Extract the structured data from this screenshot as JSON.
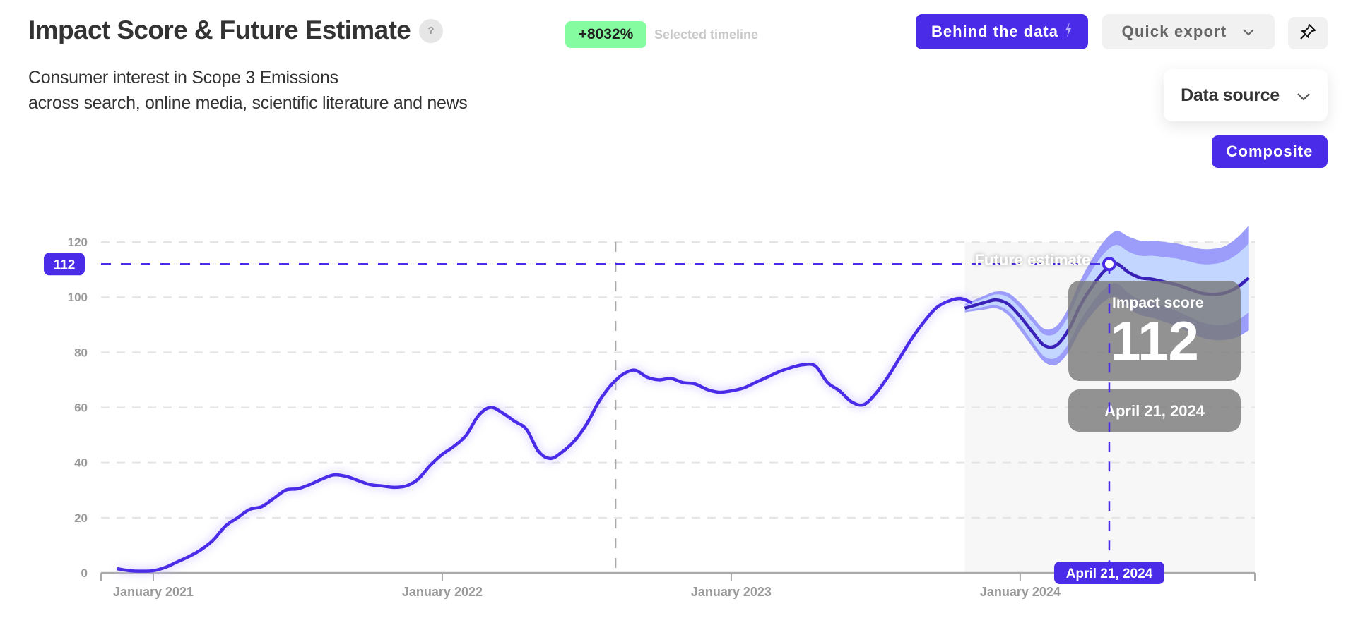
{
  "header": {
    "title": "Impact Score & Future Estimate",
    "help_label": "?",
    "subtitle_line1": "Consumer interest in Scope 3 Emissions",
    "subtitle_line2": "across search, online media, scientific literature and news",
    "change_badge": "+8032%",
    "change_note": "Selected timeline"
  },
  "toolbar": {
    "behind_the_data_label": "Behind the data",
    "quick_export_label": "Quick export",
    "data_source_label": "Data source",
    "composite_label": "Composite",
    "icons": {
      "behind": "lightning-icon",
      "export": "chevron-down-icon",
      "pin": "pin-icon",
      "data_source": "chevron-down-icon"
    }
  },
  "colors": {
    "accent": "#4a2ce8",
    "forecast_band_outer": "#9c9cfa",
    "forecast_band_inner": "#c3d6ff",
    "forecast_line": "#3a22b8",
    "forecast_bg": "#f7f7f7",
    "badge_green": "#86fca0"
  },
  "chart_data": {
    "type": "line",
    "title": "Impact Score & Future Estimate",
    "xlabel": "",
    "ylabel": "Impact score",
    "ylim": [
      0,
      120
    ],
    "yticks": [
      0,
      20,
      40,
      60,
      80,
      100,
      120
    ],
    "x_unit": "months since January 2021",
    "xlim": [
      -2.2,
      45.7
    ],
    "xticks": [
      {
        "x": 0,
        "label": "January 2021"
      },
      {
        "x": 12,
        "label": "January 2022"
      },
      {
        "x": 24,
        "label": "January 2023"
      },
      {
        "x": 36,
        "label": "January 2024"
      }
    ],
    "grid": true,
    "series": [
      {
        "name": "Impact score",
        "x": [
          -1.5,
          -1.0,
          -0.5,
          0,
          0.5,
          1,
          1.5,
          2,
          2.5,
          3,
          3.5,
          4,
          4.5,
          5,
          5.5,
          6,
          6.5,
          7,
          7.5,
          8,
          8.5,
          9,
          9.5,
          10,
          10.5,
          11,
          11.5,
          12,
          12.5,
          13,
          13.5,
          14,
          14.5,
          15,
          15.5,
          16,
          16.5,
          17,
          17.5,
          18,
          18.5,
          19,
          19.5,
          20,
          20.5,
          21,
          21.5,
          22,
          22.5,
          23,
          23.5,
          24,
          24.5,
          25,
          25.5,
          26,
          26.5,
          27,
          27.5,
          28,
          28.5,
          29,
          29.5,
          30,
          30.5,
          31,
          31.5,
          32,
          32.5,
          33,
          33.5,
          34
        ],
        "values": [
          1.5,
          0.8,
          0.6,
          0.8,
          2,
          4,
          6,
          8.5,
          12,
          17,
          20,
          23,
          24,
          27,
          30,
          30.5,
          32,
          34,
          35.5,
          35,
          33.5,
          32,
          31.5,
          31,
          31.5,
          34,
          39,
          43,
          46,
          50,
          57,
          60,
          58,
          55,
          52,
          44,
          41.5,
          44,
          48,
          54,
          62,
          68,
          72,
          73.5,
          71,
          70,
          70.5,
          69,
          68.5,
          66.5,
          65.5,
          66,
          67,
          69,
          71,
          73,
          74.5,
          75.5,
          75,
          69,
          66,
          62,
          61,
          65,
          71,
          78,
          85,
          91,
          96,
          98.5,
          99.5,
          98,
          97,
          92,
          86,
          83,
          81,
          81,
          84,
          90,
          94,
          96
        ]
      },
      {
        "name": "Future estimate",
        "x": [
          33.7,
          34.5,
          35,
          35.5,
          36,
          36.5,
          37,
          37.5,
          38,
          38.5,
          39,
          39.5,
          40,
          40.5,
          41,
          41.5,
          42,
          42.5,
          43,
          43.5,
          44,
          44.5,
          45,
          45.5
        ],
        "values": [
          96,
          98,
          99,
          97.5,
          93,
          87.5,
          82.5,
          82.5,
          88,
          97,
          104,
          109.5,
          112,
          109,
          107,
          106.5,
          105.5,
          104.5,
          103,
          101.5,
          101,
          101.5,
          103.5,
          107
        ],
        "band_inner_halfwidth": [
          1,
          1.5,
          2,
          2.5,
          3,
          3.5,
          4,
          4.5,
          5,
          5.5,
          6,
          6.5,
          7,
          7.5,
          8,
          8.5,
          9,
          9.5,
          10,
          10.5,
          11,
          11.5,
          12,
          12.5
        ],
        "band_outer_halfwidth": [
          1.5,
          2.5,
          3,
          4,
          5,
          5.5,
          6,
          7,
          8,
          9,
          10,
          11,
          12,
          13,
          13.5,
          14,
          14.5,
          15,
          15.5,
          16,
          16.5,
          17,
          18,
          19
        ]
      }
    ],
    "forecast_region_start": 33.7,
    "reference_line_x": 19.2,
    "annotations": {
      "forecast_label": "Future estimate",
      "selected_value_label": "112",
      "selected_value": 112,
      "selected_date_label": "April 21, 2024",
      "selected_x": 39.7,
      "tooltip_title": "Impact score",
      "tooltip_value": "112",
      "tooltip_date": "April 21, 2024"
    }
  }
}
